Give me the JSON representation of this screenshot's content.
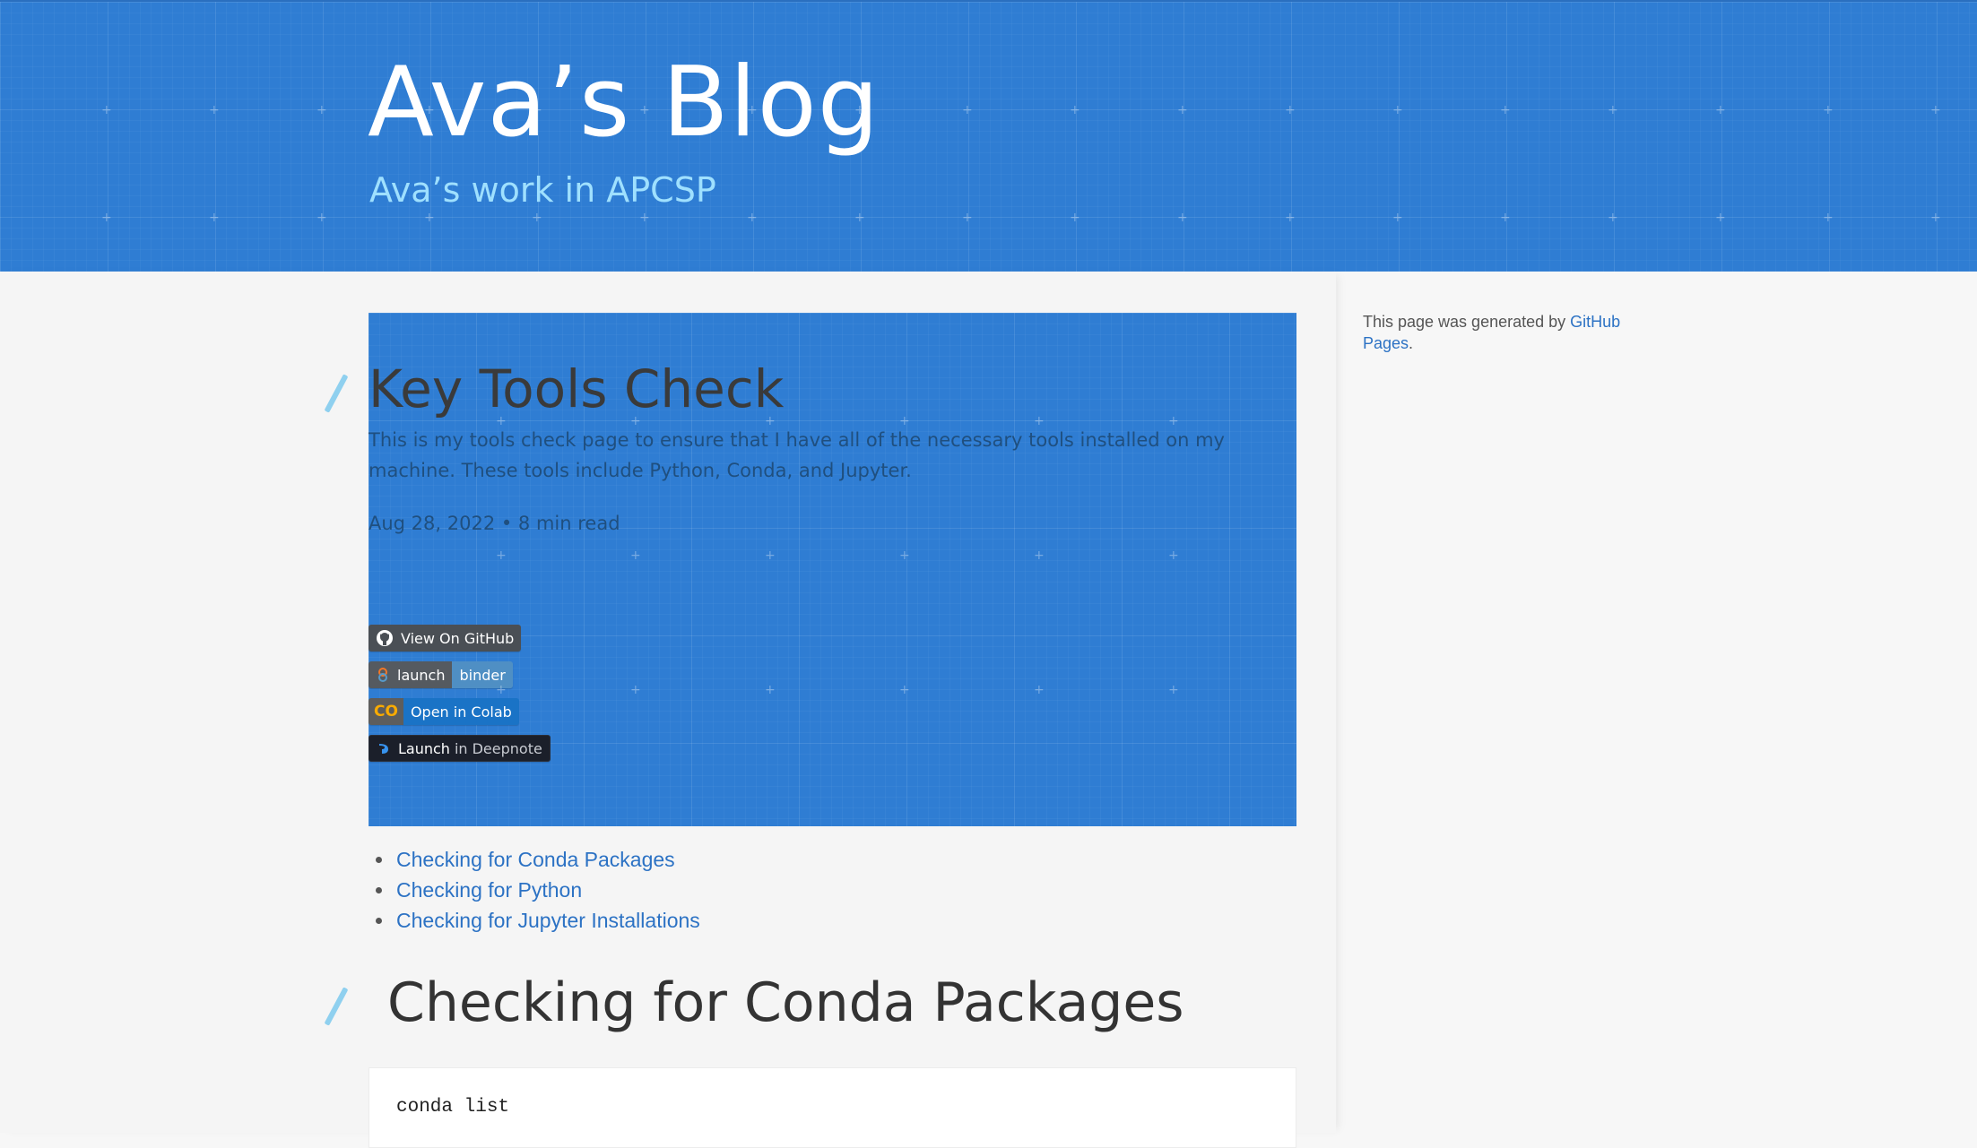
{
  "header": {
    "title": "Ava’s Blog",
    "subtitle": "Ava’s work in APCSP"
  },
  "post": {
    "title": "Key Tools Check",
    "description": "This is my tools check page to ensure that I have all of the necessary tools installed on my machine. These tools include Python, Conda, and Jupyter.",
    "meta": "Aug 28, 2022 • 8 min read"
  },
  "badges": {
    "github": {
      "label": "View On GitHub"
    },
    "binder": {
      "left": "launch",
      "right": "binder"
    },
    "colab": {
      "left": "CO",
      "right": "Open in Colab"
    },
    "deepnote": {
      "strong": "Launch",
      "dim": "in Deepnote"
    }
  },
  "toc": {
    "items": [
      {
        "label": "Checking for Conda Packages"
      },
      {
        "label": "Checking for Python"
      },
      {
        "label": "Checking for Jupyter Installations"
      }
    ]
  },
  "section": {
    "heading": "Checking for Conda Packages",
    "code": "conda list"
  },
  "sidebar": {
    "note_prefix": "This page was generated by ",
    "note_link": "GitHub Pages",
    "note_suffix": "."
  },
  "colors": {
    "header_blue": "#2f7dd3",
    "link_blue": "#2c72c4",
    "subtitle_cyan": "#9fe0ff",
    "accent_slash": "#8fd0ef"
  }
}
